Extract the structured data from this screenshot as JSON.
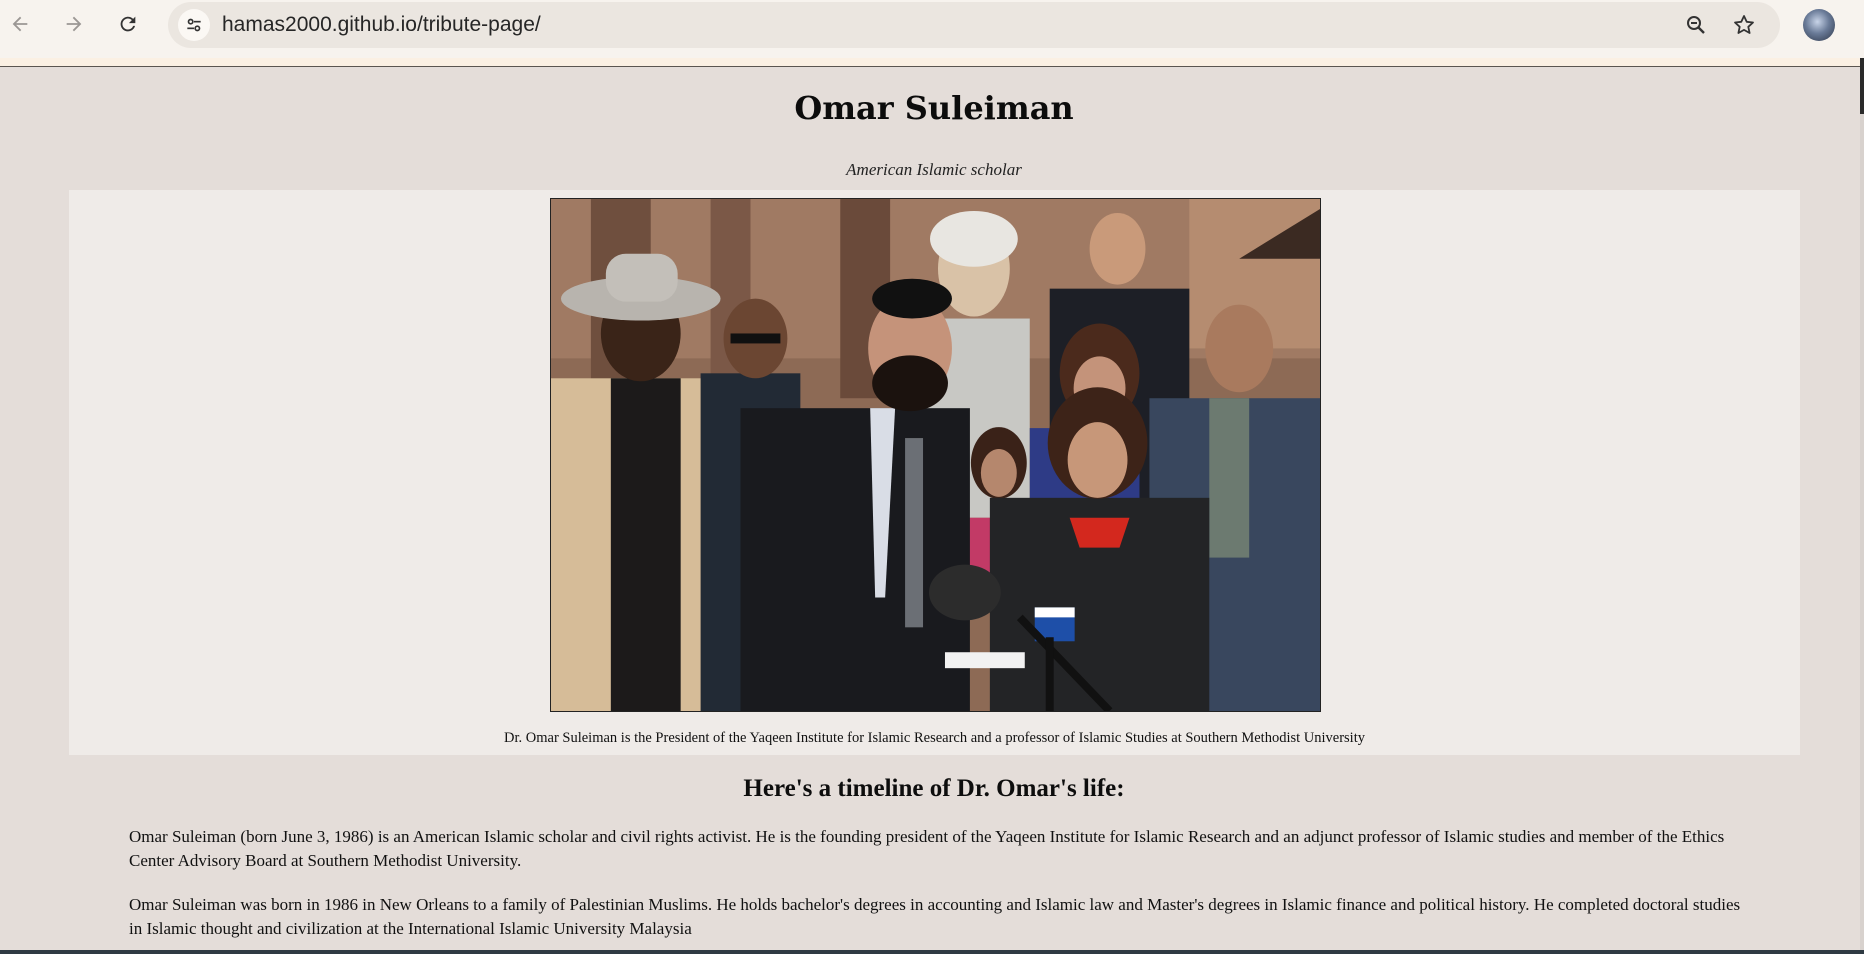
{
  "browser": {
    "url": "hamas2000.github.io/tribute-page/",
    "back_icon": "arrow-left-icon",
    "forward_icon": "arrow-right-icon",
    "reload_icon": "reload-icon",
    "site_info_icon": "tune-icon",
    "zoom_icon": "zoom-out-icon",
    "bookmark_icon": "star-icon"
  },
  "page": {
    "title": "Omar Suleiman",
    "subtitle": "American Islamic scholar",
    "image_caption": "Dr. Omar Suleiman is the President of the Yaqeen Institute for Islamic Research and a professor of Islamic Studies at Southern Methodist University",
    "timeline_heading": "Here's a timeline of Dr. Omar's life:",
    "paragraphs": [
      "Omar Suleiman (born June 3, 1986) is an American Islamic scholar and civil rights activist. He is the founding president of the Yaqeen Institute for Islamic Research and an adjunct professor of Islamic studies and member of the Ethics Center Advisory Board at Southern Methodist University.",
      "Omar Suleiman was born in 1986 in New Orleans to a family of Palestinian Muslims. He holds bachelor's degrees in accounting and Islamic law and Master's degrees in Islamic finance and political history. He completed doctoral studies in Islamic thought and civilization at the International Islamic University Malaysia"
    ]
  },
  "colors": {
    "page_background": "#e4ddd9",
    "image_panel_background": "#efebe8",
    "browser_toolbar": "#f7f3ee"
  }
}
